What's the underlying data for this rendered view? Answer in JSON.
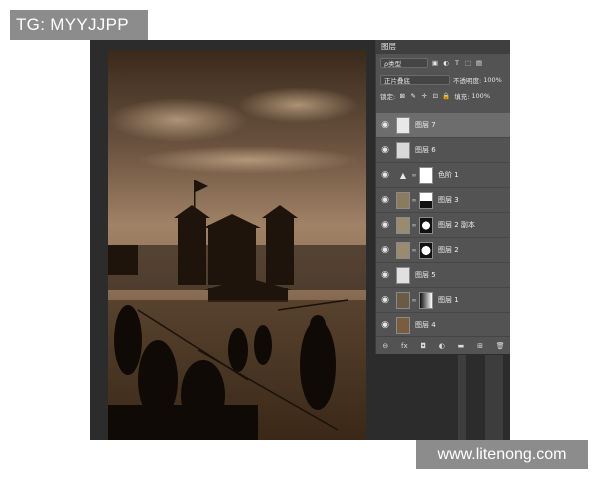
{
  "watermark_top": "TG: MYYJJPP",
  "watermark_bottom": "www.litenong.com",
  "layers_panel": {
    "tab_title": "图层",
    "filter_kind": "ρ类型",
    "blend_mode": "正片叠底",
    "opacity_label": "不透明度:",
    "opacity_value": "100%",
    "lock_label": "锁定:",
    "fill_label": "填充:",
    "fill_value": "100%",
    "layers": [
      {
        "name": "图层 7",
        "selected": true,
        "type": "layer"
      },
      {
        "name": "图层 6",
        "selected": false,
        "type": "layer"
      },
      {
        "name": "色阶 1",
        "selected": false,
        "type": "adjustment"
      },
      {
        "name": "图层 3",
        "selected": false,
        "type": "masked"
      },
      {
        "name": "图层 2 副本",
        "selected": false,
        "type": "masked"
      },
      {
        "name": "图层 2",
        "selected": false,
        "type": "masked"
      },
      {
        "name": "图层 5",
        "selected": false,
        "type": "layer"
      },
      {
        "name": "图层 1",
        "selected": false,
        "type": "masked"
      },
      {
        "name": "图层 4",
        "selected": false,
        "type": "fill"
      }
    ],
    "bottom_icons": [
      "link-icon",
      "fx-icon",
      "mask-icon",
      "adjustment-icon",
      "folder-icon",
      "new-layer-icon",
      "trash-icon"
    ],
    "bottom_glyphs": [
      "⊖",
      "fx",
      "◘",
      "◐",
      "▬",
      "⊞",
      "🗑"
    ]
  },
  "colors": {
    "panel_bg": "#535353",
    "selected_row": "#6d6d6d",
    "workspace_bg": "#2c2c2c",
    "sepia_dark": "#2a1d12",
    "sepia_light": "#a8876a"
  }
}
